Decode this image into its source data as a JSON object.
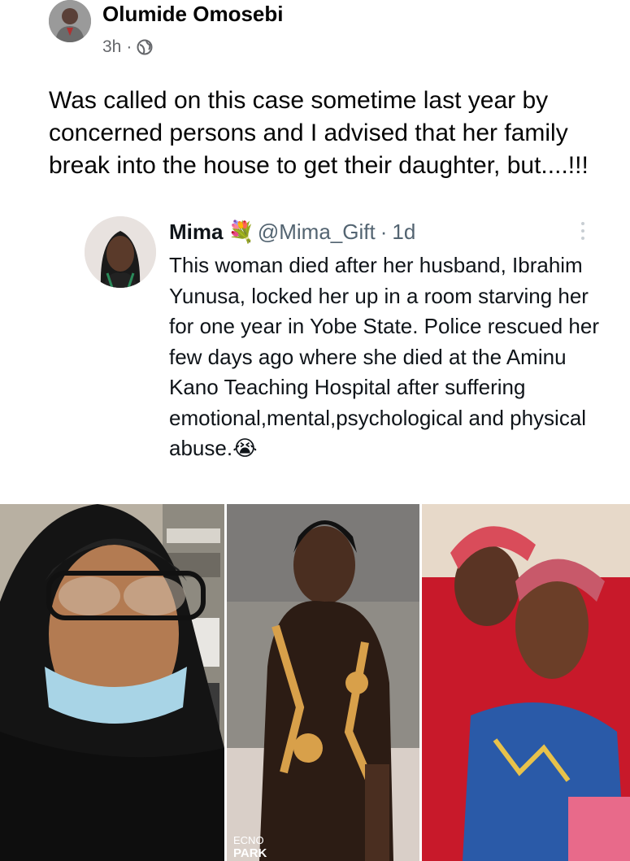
{
  "post": {
    "author": "Olumide Omosebi",
    "time": "3h",
    "separator": "·",
    "text": "Was called on this case sometime last year by concerned persons and I advised that her family break into the house to get their daughter, but....!!!"
  },
  "tweet": {
    "name": "Mima",
    "name_emoji": "💐",
    "handle": "@Mima_Gift",
    "dot": "·",
    "time": "1d",
    "text": "This woman died after her husband, Ibrahim Yunusa, locked her up in a room starving her for one year in Yobe State. Police rescued her few days ago where she died at the Aminu Kano Teaching Hospital after suffering emotional,mental,psychological and physical abuse.",
    "end_emoji": "😭"
  },
  "photos": {
    "watermark_line1": "ECNO",
    "watermark_line2": "PARK"
  },
  "colors": {
    "meta_gray": "#65676b",
    "twitter_gray": "#536471"
  }
}
